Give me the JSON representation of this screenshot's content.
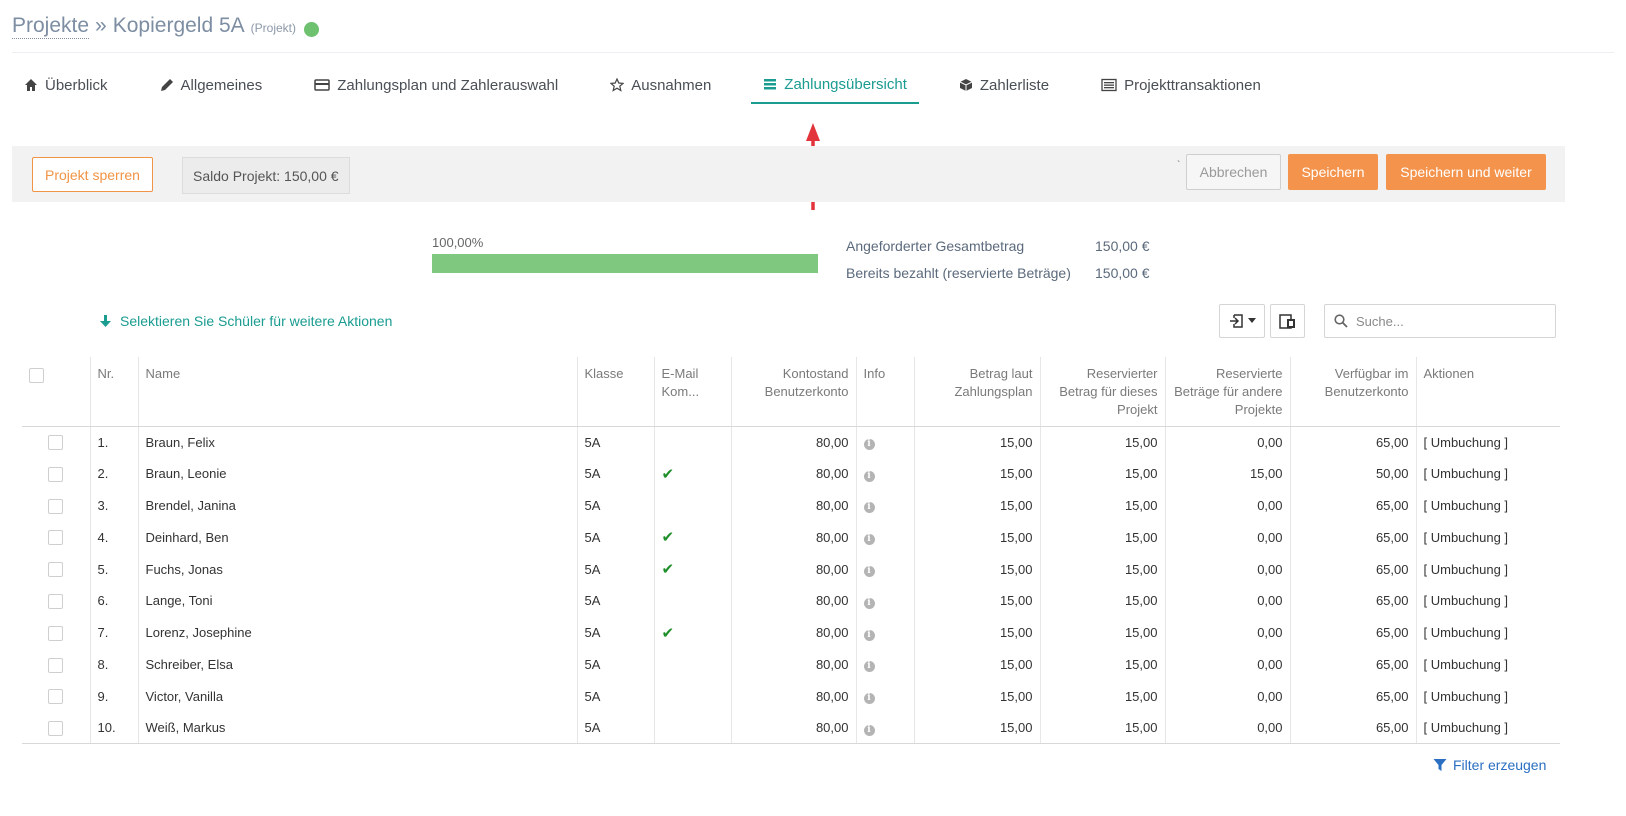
{
  "breadcrumb": {
    "root": "Projekte",
    "separator": "»",
    "name": "Kopiergeld 5A",
    "type": "(Projekt)",
    "status_color": "#6dc16f"
  },
  "tabs": [
    {
      "label": "Überblick",
      "icon": "home-icon"
    },
    {
      "label": "Allgemeines",
      "icon": "pencil-icon"
    },
    {
      "label": "Zahlungsplan und Zahlerauswahl",
      "icon": "credit-card-icon"
    },
    {
      "label": "Ausnahmen",
      "icon": "star-icon"
    },
    {
      "label": "Zahlungsübersicht",
      "icon": "list-icon",
      "active": true
    },
    {
      "label": "Zahlerliste",
      "icon": "cube-icon"
    },
    {
      "label": "Projekttransaktionen",
      "icon": "list-alt-icon"
    }
  ],
  "toolbar": {
    "lock_label": "Projekt sperren",
    "saldo": "Saldo Projekt: 150,00 €",
    "tick": "`",
    "cancel_label": "Abbrechen",
    "save_label": "Speichern",
    "save_next_label": "Speichern und weiter"
  },
  "summary": {
    "progress_label": "100,00%",
    "progress": 1.0,
    "requested_label": "Angeforderter Gesamtbetrag",
    "requested_value": "150,00 €",
    "paid_label": "Bereits bezahlt (reservierte Beträge)",
    "paid_value": "150,00 €"
  },
  "actions": {
    "select_hint": "Selektieren Sie Schüler für weitere Aktionen",
    "search_placeholder": "Suche...",
    "filter_label": "Filter erzeugen"
  },
  "table": {
    "headers": {
      "nr": "Nr.",
      "name": "Name",
      "klasse": "Klasse",
      "email": "E-Mail Kom...",
      "kontostand": "Kontostand Benutzerkonto",
      "info": "Info",
      "betrag": "Betrag laut Zahlungsplan",
      "reserviert": "Reservierter Betrag für dieses Projekt",
      "andere": "Reservierte Beträge für andere Projekte",
      "verfuegbar": "Verfügbar im Benutzerkonto",
      "aktionen": "Aktionen"
    },
    "rows": [
      {
        "nr": "1.",
        "name": "Braun, Felix",
        "klasse": "5A",
        "email": false,
        "kontostand": "80,00",
        "betrag": "15,00",
        "reserviert": "15,00",
        "andere": "0,00",
        "verfuegbar": "65,00",
        "aktion": "[ Umbuchung ]"
      },
      {
        "nr": "2.",
        "name": "Braun, Leonie",
        "klasse": "5A",
        "email": true,
        "kontostand": "80,00",
        "betrag": "15,00",
        "reserviert": "15,00",
        "andere": "15,00",
        "verfuegbar": "50,00",
        "aktion": "[ Umbuchung ]"
      },
      {
        "nr": "3.",
        "name": "Brendel, Janina",
        "klasse": "5A",
        "email": false,
        "kontostand": "80,00",
        "betrag": "15,00",
        "reserviert": "15,00",
        "andere": "0,00",
        "verfuegbar": "65,00",
        "aktion": "[ Umbuchung ]"
      },
      {
        "nr": "4.",
        "name": "Deinhard, Ben",
        "klasse": "5A",
        "email": true,
        "kontostand": "80,00",
        "betrag": "15,00",
        "reserviert": "15,00",
        "andere": "0,00",
        "verfuegbar": "65,00",
        "aktion": "[ Umbuchung ]"
      },
      {
        "nr": "5.",
        "name": "Fuchs, Jonas",
        "klasse": "5A",
        "email": true,
        "kontostand": "80,00",
        "betrag": "15,00",
        "reserviert": "15,00",
        "andere": "0,00",
        "verfuegbar": "65,00",
        "aktion": "[ Umbuchung ]"
      },
      {
        "nr": "6.",
        "name": "Lange, Toni",
        "klasse": "5A",
        "email": false,
        "kontostand": "80,00",
        "betrag": "15,00",
        "reserviert": "15,00",
        "andere": "0,00",
        "verfuegbar": "65,00",
        "aktion": "[ Umbuchung ]"
      },
      {
        "nr": "7.",
        "name": "Lorenz, Josephine",
        "klasse": "5A",
        "email": true,
        "kontostand": "80,00",
        "betrag": "15,00",
        "reserviert": "15,00",
        "andere": "0,00",
        "verfuegbar": "65,00",
        "aktion": "[ Umbuchung ]"
      },
      {
        "nr": "8.",
        "name": "Schreiber, Elsa",
        "klasse": "5A",
        "email": false,
        "kontostand": "80,00",
        "betrag": "15,00",
        "reserviert": "15,00",
        "andere": "0,00",
        "verfuegbar": "65,00",
        "aktion": "[ Umbuchung ]"
      },
      {
        "nr": "9.",
        "name": "Victor, Vanilla",
        "klasse": "5A",
        "email": false,
        "kontostand": "80,00",
        "betrag": "15,00",
        "reserviert": "15,00",
        "andere": "0,00",
        "verfuegbar": "65,00",
        "aktion": "[ Umbuchung ]"
      },
      {
        "nr": "10.",
        "name": "Weiß, Markus",
        "klasse": "5A",
        "email": false,
        "kontostand": "80,00",
        "betrag": "15,00",
        "reserviert": "15,00",
        "andere": "0,00",
        "verfuegbar": "65,00",
        "aktion": "[ Umbuchung ]"
      }
    ]
  },
  "colors": {
    "accent": "#1a9c91",
    "orange": "#f4934b",
    "link": "#2a6fc2",
    "progress": "#7ec87f",
    "annotation_arrow": "#e2353b"
  }
}
